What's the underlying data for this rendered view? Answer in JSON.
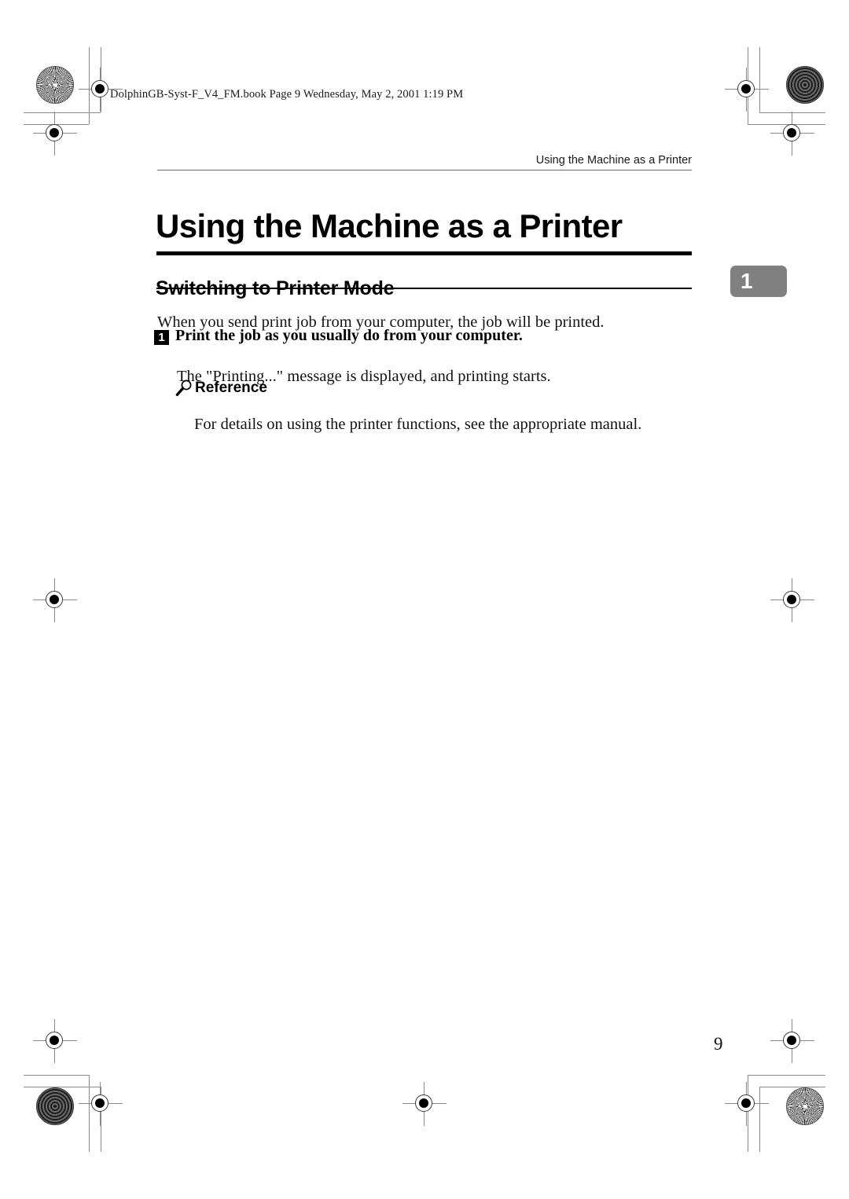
{
  "print_info": {
    "book_line": "DolphinGB-Syst-F_V4_FM.book  Page 9  Wednesday, May 2, 2001  1:19 PM"
  },
  "header": {
    "running_header": "Using the Machine as a Printer"
  },
  "chapter": {
    "title": "Using the Machine as a Printer",
    "tab_number": "1"
  },
  "section": {
    "heading": "Switching to Printer Mode",
    "intro": "When you send print job from your computer, the job will be printed.",
    "step": {
      "number": "1",
      "text": "Print the job as you usually do from your computer.",
      "result": "The \"Printing...\" message is displayed, and printing starts."
    },
    "reference": {
      "icon": "magnifier-icon",
      "label": "Reference",
      "text": "For details on using the printer functions, see the appropriate manual."
    }
  },
  "footer": {
    "page_number": "9"
  },
  "colors": {
    "tab_gray": "#808080",
    "rule_black": "#000000",
    "crop_gray": "#8a8a8a"
  }
}
